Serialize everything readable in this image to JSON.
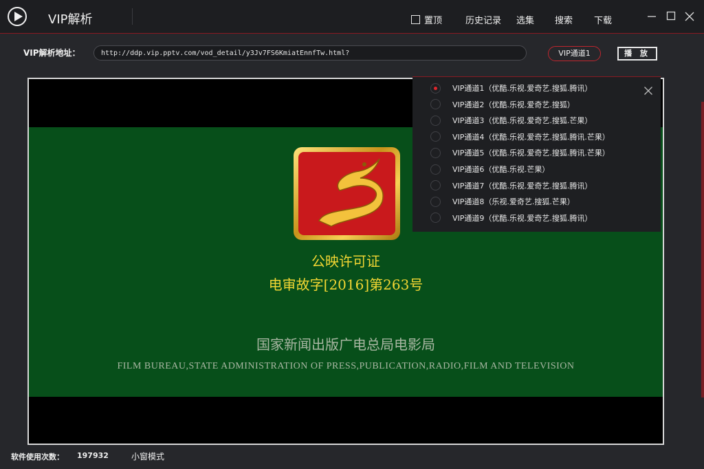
{
  "app": {
    "title": "VIP解析"
  },
  "topbar": {
    "pin_label": "置顶",
    "nav": [
      "历史记录",
      "选集",
      "搜索",
      "下载"
    ]
  },
  "address": {
    "label": "VIP解析地址：",
    "url": "http://ddp.vip.pptv.com/vod_detail/y3Jv7FS6KmiatEnnfTw.html?",
    "channel_button": "VIP通道1",
    "play_button": "播 放"
  },
  "video": {
    "license_line1": "公映许可证",
    "license_line2": "电审故字[2016]第263号",
    "bureau_cn": "国家新闻出版广电总局电影局",
    "bureau_en": "FILM BUREAU,STATE ADMINISTRATION OF PRESS,PUBLICATION,RADIO,FILM AND TELEVISION"
  },
  "dropdown": {
    "selected_index": 0,
    "items": [
      "VIP通道1（优酷.乐视.爱奇艺.搜狐.腾讯）",
      "VIP通道2（优酷.乐视.爱奇艺.搜狐）",
      "VIP通道3（优酷.乐视.爱奇艺.搜狐.芒果）",
      "VIP通道4（优酷.乐视.爱奇艺.搜狐.腾讯.芒果）",
      "VIP通道5（优酷.乐视.爱奇艺.搜狐.腾讯.芒果）",
      "VIP通道6（优酷.乐视.芒果）",
      "VIP通道7（优酷.乐视.爱奇艺.搜狐.腾讯）",
      "VIP通道8（乐视.爱奇艺.搜狐.芒果）",
      "VIP通道9（优酷.乐视.爱奇艺.搜狐.腾讯）"
    ]
  },
  "status": {
    "usage_label": "软件使用次数：",
    "usage_count": "197932",
    "mini_mode": "小窗模式"
  },
  "colors": {
    "accent": "#c0262f",
    "background": "#26272b",
    "license_text": "#f2d633",
    "video_green": "#074f1a"
  }
}
